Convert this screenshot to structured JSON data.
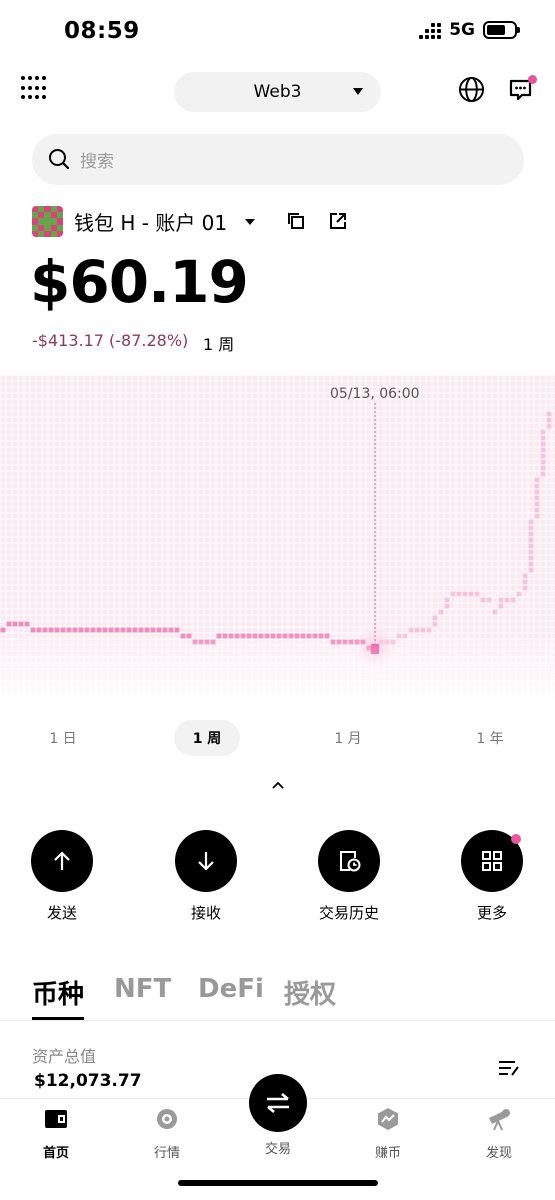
{
  "status_bar": {
    "time": "08:59",
    "network": "5G"
  },
  "header": {
    "network_label": "Web3"
  },
  "search": {
    "placeholder": "搜索"
  },
  "account": {
    "name": "钱包 H - 账户 01"
  },
  "balance": {
    "amount": "$60.19",
    "change": "-$413.17 (-87.28%)",
    "period": "1 周"
  },
  "chart_data": {
    "type": "line",
    "tooltip_label": "05/13, 06:00",
    "x": [
      0,
      1,
      2,
      3,
      4,
      5,
      6,
      7,
      8,
      9,
      10,
      11,
      12,
      13,
      14,
      15,
      16,
      17,
      18,
      19,
      20,
      21,
      22,
      23,
      24,
      25,
      26,
      27,
      28,
      29,
      30,
      31,
      32,
      33,
      34,
      35,
      36,
      37,
      38,
      39,
      40,
      41,
      42,
      43,
      44,
      45,
      46,
      47,
      48,
      49,
      50,
      51,
      52,
      53,
      54,
      55,
      56,
      57,
      58,
      59,
      60,
      61,
      62,
      63,
      64,
      65,
      66,
      67,
      68,
      69,
      70,
      71,
      72,
      73,
      74,
      75,
      76,
      77,
      78,
      79,
      80,
      81,
      82,
      83,
      84,
      85,
      86,
      87,
      88,
      89,
      90,
      91
    ],
    "values": [
      12,
      13,
      13,
      13,
      13,
      12,
      12,
      12,
      12,
      12,
      12,
      12,
      12,
      12,
      12,
      12,
      12,
      12,
      12,
      12,
      12,
      12,
      12,
      12,
      12,
      12,
      12,
      12,
      12,
      12,
      11,
      11,
      10,
      10,
      10,
      10,
      11,
      11,
      11,
      11,
      11,
      11,
      11,
      11,
      11,
      11,
      11,
      11,
      11,
      11,
      11,
      11,
      11,
      11,
      11,
      10,
      10,
      10,
      10,
      10,
      10,
      9,
      9,
      10,
      10,
      10,
      11,
      11,
      12,
      12,
      12,
      12,
      14,
      15,
      16,
      17,
      17,
      17,
      17,
      17,
      16,
      16,
      15,
      16,
      16,
      16,
      17,
      20,
      28,
      35,
      42,
      45
    ],
    "marker_index": 62
  },
  "ranges": [
    "1 日",
    "1 周",
    "1 月",
    "1 年"
  ],
  "actions": {
    "send": "发送",
    "receive": "接收",
    "history": "交易历史",
    "more": "更多"
  },
  "asset_tabs": [
    "币种",
    "NFT",
    "DeFi",
    "授权"
  ],
  "assets": {
    "total_label": "资产总值",
    "total_value": "$12,073.77"
  },
  "nav": {
    "home": "首页",
    "market": "行情",
    "trade": "交易",
    "earn": "赚币",
    "discover": "发现"
  },
  "colors": {
    "accent": "#e8559a",
    "change_negative": "#8b3a62"
  }
}
